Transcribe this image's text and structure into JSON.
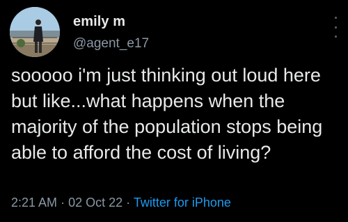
{
  "tweet": {
    "display_name": "emily m",
    "handle": "@agent_e17",
    "text": "sooooo i'm just thinking out loud here but like...what happens when the majority of the population stops being able to afford the cost of living?",
    "time": "2:21 AM",
    "separator": "·",
    "date": "02 Oct 22",
    "source": "Twitter for iPhone"
  },
  "icons": {
    "avatar": "profile-photo",
    "more": "more-options-icon"
  },
  "colors": {
    "background": "#000000",
    "primary_text": "#e7e9ea",
    "secondary_text": "#8b98a5",
    "link": "#1d9bf0"
  }
}
